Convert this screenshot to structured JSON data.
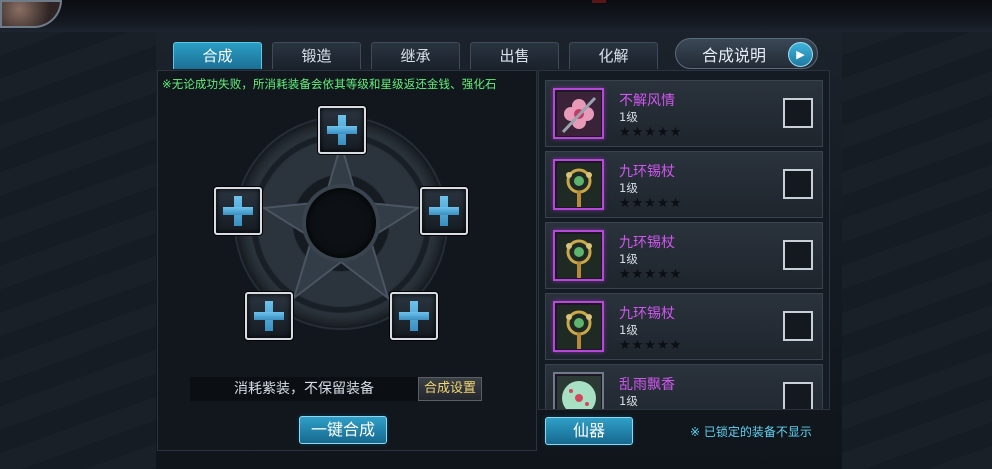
{
  "tabs": [
    {
      "label": "合成"
    },
    {
      "label": "锻造"
    },
    {
      "label": "继承"
    },
    {
      "label": "出售"
    },
    {
      "label": "化解"
    }
  ],
  "help_button": {
    "label": "合成说明"
  },
  "notice": "※无论成功失败，所消耗装备会依其等级和星级返还金钱、强化石",
  "slots": [
    "empty-slot",
    "empty-slot",
    "empty-slot",
    "empty-slot",
    "empty-slot"
  ],
  "consume_option": "消耗紫装，不保留装备",
  "setting_button": "合成设置",
  "merge_button": "一键合成",
  "category_button": "仙器",
  "lock_note": "※ 已锁定的装备不显示",
  "items": [
    {
      "name": "不解风情",
      "level": "1级",
      "stars": "★★★★★",
      "stars_filled": 0,
      "icon": "flower-weapon-icon",
      "checked": false
    },
    {
      "name": "九环锡杖",
      "level": "1级",
      "stars": "★★★★★",
      "stars_filled": 0,
      "icon": "ringed-staff-icon",
      "checked": false
    },
    {
      "name": "九环锡杖",
      "level": "1级",
      "stars": "★★★★★",
      "stars_filled": 0,
      "icon": "ringed-staff-icon",
      "checked": false
    },
    {
      "name": "九环锡杖",
      "level": "1级",
      "stars": "★★★★★",
      "stars_filled": 0,
      "icon": "ringed-staff-icon",
      "checked": false
    },
    {
      "name": "乱雨飘香",
      "level": "1级",
      "stars": "★★★★★",
      "stars_filled": 0,
      "icon": "umbrella-weapon-icon",
      "checked": false
    }
  ],
  "colors": {
    "active_tab": "#2b9ec4",
    "notice_text": "#5ff07a",
    "purple_item": "#d057ef",
    "note_text": "#5fd3f2",
    "setting_text": "#f3d772"
  }
}
